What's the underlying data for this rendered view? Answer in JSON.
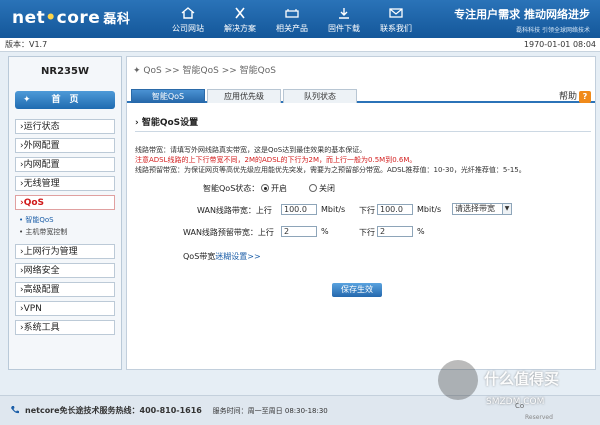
{
  "header": {
    "logo_main": "net",
    "logo_dot": "•",
    "logo_rest": "core",
    "logo_cn": "磊科",
    "nav": [
      {
        "label": "公司网站",
        "icon": "home-icon"
      },
      {
        "label": "解决方案",
        "icon": "tools-icon"
      },
      {
        "label": "相关产品",
        "icon": "product-icon"
      },
      {
        "label": "固件下载",
        "icon": "download-icon"
      },
      {
        "label": "联系我们",
        "icon": "contact-icon"
      }
    ],
    "slogan": "专注用户需求  推动网络进步",
    "slogan_sub": "磊科科技  引领全球网络技术"
  },
  "version_bar": {
    "version": "版本：V1.7",
    "datetime": "1970-01-01 08:04"
  },
  "sidebar": {
    "model": "NR235W",
    "home": "首　页",
    "menu": [
      {
        "label": "›运行状态"
      },
      {
        "label": "›外网配置"
      },
      {
        "label": "›内网配置"
      },
      {
        "label": "›无线管理"
      },
      {
        "label": "›QoS"
      }
    ],
    "submenu": [
      {
        "label": "• 智能QoS"
      },
      {
        "label": "• 主机带宽控制"
      }
    ],
    "menu2": [
      {
        "label": "›上网行为管理"
      },
      {
        "label": "›网络安全"
      },
      {
        "label": "›高级配置"
      },
      {
        "label": "›VPN"
      },
      {
        "label": "›系统工具"
      }
    ]
  },
  "main": {
    "breadcrumb": "QoS  >>  智能QoS  >>  智能QoS",
    "tabs": [
      "智能QoS",
      "应用优先级",
      "队列状态"
    ],
    "help": "帮助",
    "section_title": "› 智能QoS设置",
    "desc1": "线路带宽：请填写外网线路真实带宽，这是QoS达到最佳效果的基本保证。",
    "desc2": "注意ADSL线路的上下行带宽不同，2M的ADSL的下行为2M，而上行一般为0.5M到0.6M。",
    "desc3": "线路预留带宽：为保证网页等高优先级应用能优先突发，需要为之预留部分带宽。ADSL推荐值：10-30，光纤推荐值：5-15。",
    "qos_status_label": "智能QoS状态：",
    "on_label": "开启",
    "off_label": "关闭",
    "wan_bw_label": "WAN线路带宽：上行",
    "up_bw": "100.0",
    "unit_mbps": "Mbit/s",
    "down_label": "下行",
    "down_bw": "100.0",
    "bw_select": "请选择带宽",
    "reserve_label": "WAN线路预留带宽：上行",
    "up_reserve": "2",
    "percent": "%",
    "down_reserve": "2",
    "guide_prefix": "QoS带宽",
    "guide_link": "迷糊设置>>",
    "save": "保存生效"
  },
  "footer": {
    "hotline": "netcore免长途技术服务热线：400-810-1616",
    "hours": "服务时间：周一至周日 08:30-18:30",
    "copyright": "Co",
    "reserved": "Reserved"
  },
  "watermark": {
    "text": "什么值得买",
    "sub": "SMZDM.COM"
  }
}
